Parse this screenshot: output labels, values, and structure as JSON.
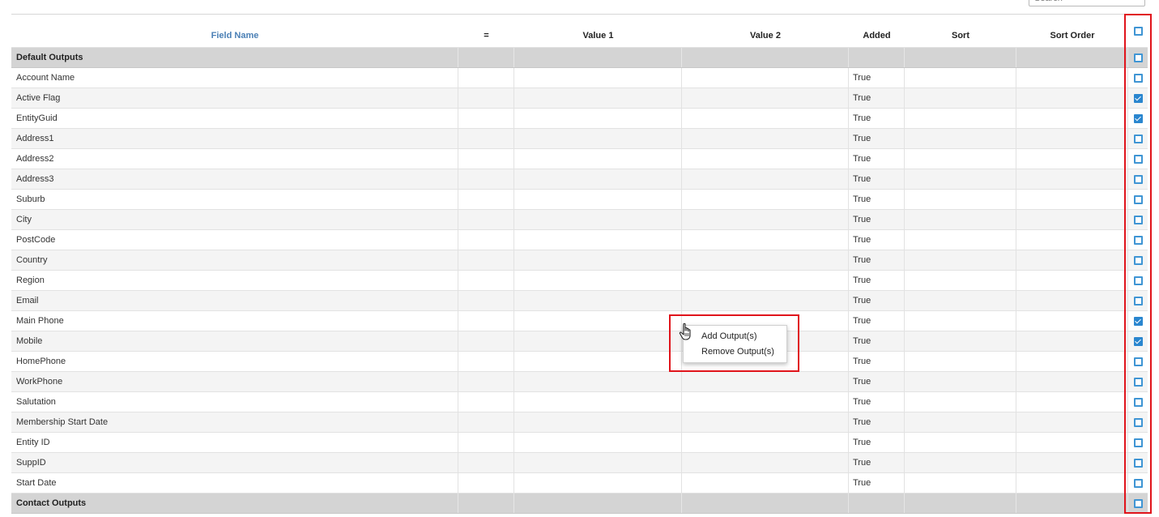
{
  "search": {
    "placeholder": "Search"
  },
  "columns": {
    "field_name": "Field Name",
    "equals": "=",
    "value1": "Value 1",
    "value2": "Value 2",
    "added": "Added",
    "sort": "Sort",
    "sort_order": "Sort Order"
  },
  "header_checkbox_checked": false,
  "groups": [
    {
      "label": "Default Outputs",
      "checked": false
    },
    {
      "label": "Contact Outputs",
      "checked": false
    }
  ],
  "rows": [
    {
      "field": "Account Name",
      "added": "True",
      "checked": false
    },
    {
      "field": "Active Flag",
      "added": "True",
      "checked": true
    },
    {
      "field": "EntityGuid",
      "added": "True",
      "checked": true
    },
    {
      "field": "Address1",
      "added": "True",
      "checked": false
    },
    {
      "field": "Address2",
      "added": "True",
      "checked": false
    },
    {
      "field": "Address3",
      "added": "True",
      "checked": false
    },
    {
      "field": "Suburb",
      "added": "True",
      "checked": false
    },
    {
      "field": "City",
      "added": "True",
      "checked": false
    },
    {
      "field": "PostCode",
      "added": "True",
      "checked": false
    },
    {
      "field": "Country",
      "added": "True",
      "checked": false
    },
    {
      "field": "Region",
      "added": "True",
      "checked": false
    },
    {
      "field": "Email",
      "added": "True",
      "checked": false
    },
    {
      "field": "Main Phone",
      "added": "True",
      "checked": true
    },
    {
      "field": "Mobile",
      "added": "True",
      "checked": true
    },
    {
      "field": "HomePhone",
      "added": "True",
      "checked": false
    },
    {
      "field": "WorkPhone",
      "added": "True",
      "checked": false
    },
    {
      "field": "Salutation",
      "added": "True",
      "checked": false
    },
    {
      "field": "Membership Start Date",
      "added": "True",
      "checked": false
    },
    {
      "field": "Entity ID",
      "added": "True",
      "checked": false
    },
    {
      "field": "SuppID",
      "added": "True",
      "checked": false
    },
    {
      "field": "Start Date",
      "added": "True",
      "checked": false
    }
  ],
  "context_menu": {
    "add_label": "Add Output(s)",
    "remove_label": "Remove Output(s)"
  },
  "colors": {
    "header_link": "#4a7fb5",
    "checkbox": "#2a86cf",
    "highlight": "#e0141b",
    "group_bg": "#d4d4d4"
  }
}
